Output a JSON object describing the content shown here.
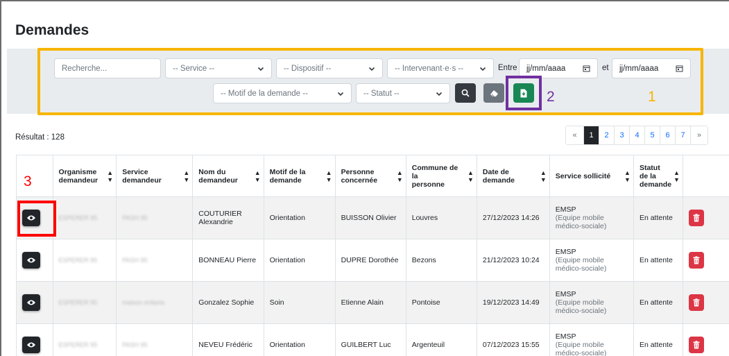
{
  "page": {
    "title": "Demandes"
  },
  "filters": {
    "search_placeholder": "Recherche...",
    "service": "-- Service --",
    "dispositif": "-- Dispositif --",
    "intervenant": "-- Intervenant·e·s --",
    "between_label": "Entre",
    "date_from_placeholder": "jj/mm/aaaa",
    "and_label": "et",
    "date_to_placeholder": "jj/mm/aaaa",
    "motif": "-- Motif de la demande --",
    "statut": "-- Statut --"
  },
  "annotations": {
    "one": "1",
    "two": "2",
    "three": "3",
    "color_orange": "#f7b500",
    "color_purple": "#7030a0",
    "color_red": "#ff0000"
  },
  "results": {
    "label": "Résultat : 128"
  },
  "pagination": {
    "prev": "«",
    "pages": [
      "1",
      "2",
      "3",
      "4",
      "5",
      "6",
      "7"
    ],
    "next": "»",
    "active": "1"
  },
  "table": {
    "headers": {
      "organisme_line1": "Organisme",
      "organisme_line2": "demandeur",
      "service_line1": "Service",
      "service_line2": "demandeur",
      "nom_line1": "Nom du",
      "nom_line2": "demandeur",
      "motif_line1": "Motif de la",
      "motif_line2": "demande",
      "personne_line1": "Personne",
      "personne_line2": "concernée",
      "commune_line1": "Commune de la",
      "commune_line2": "personne",
      "date_line1": "Date de",
      "date_line2": "demande",
      "service_sollicite": "Service sollicité",
      "statut_line1": "Statut",
      "statut_line2": "de la",
      "statut_line3": "demande"
    },
    "rows": [
      {
        "organisme": "ESPERER 95",
        "service": "PASH 95",
        "nom_line1": "COUTURIER",
        "nom_line2": "Alexandrie",
        "motif": "Orientation",
        "personne": "BUISSON Olivier",
        "commune": "Louvres",
        "date": "27/12/2023 14:26",
        "service_sollicite": "EMSP",
        "service_sollicite_detail": "(Equipe mobile médico-sociale)",
        "statut": "En attente"
      },
      {
        "organisme": "ESPERER 95",
        "service": "PASH 95",
        "nom_line1": "BONNEAU Pierre",
        "nom_line2": "",
        "motif": "Orientation",
        "personne": "DUPRE Dorothée",
        "commune": "Bezons",
        "date": "21/12/2023 10:24",
        "service_sollicite": "EMSP",
        "service_sollicite_detail": "(Equipe mobile médico-sociale)",
        "statut": "En attente"
      },
      {
        "organisme": "ESPERER 95",
        "service": "maison enfants",
        "nom_line1": "Gonzalez Sophie",
        "nom_line2": "",
        "motif": "Soin",
        "personne": "Etienne Alain",
        "commune": "Pontoise",
        "date": "19/12/2023 14:49",
        "service_sollicite": "EMSP",
        "service_sollicite_detail": "(Equipe mobile médico-sociale)",
        "statut": "En attente"
      },
      {
        "organisme": "ESPERER 95",
        "service": "PASH 95",
        "nom_line1": "NEVEU Frédéric",
        "nom_line2": "",
        "motif": "Orientation",
        "personne": "GUILBERT Luc",
        "commune": "Argenteuil",
        "date": "07/12/2023 15:55",
        "service_sollicite": "EMSP",
        "service_sollicite_detail": "(Equipe mobile médico-sociale)",
        "statut": "En attente"
      }
    ]
  },
  "icons": {
    "calendar": "calendar-icon",
    "chevron": "chevron-down-icon",
    "search": "search-icon",
    "eraser": "eraser-icon",
    "export": "file-export-icon",
    "eye": "eye-icon",
    "trash": "trash-icon",
    "sort": "sort-icon"
  }
}
